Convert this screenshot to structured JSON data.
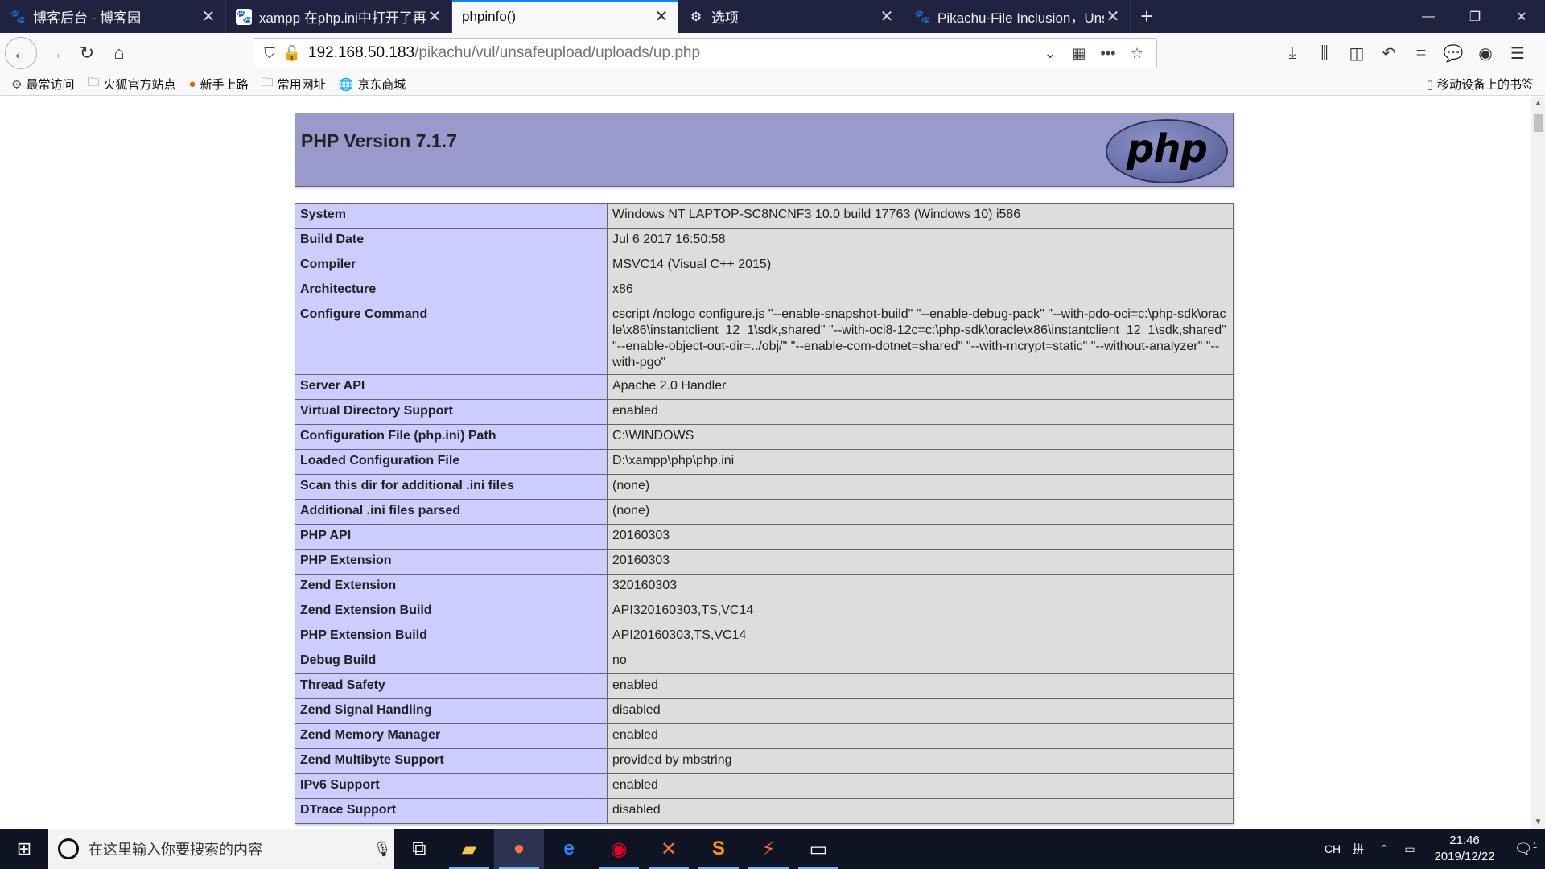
{
  "tabs": [
    {
      "title": "博客后台 - 博客园",
      "icon": "paw-icon",
      "active": false
    },
    {
      "title": "xampp 在php.ini中打开了再测",
      "icon": "baidu-paw-icon",
      "active": false
    },
    {
      "title": "phpinfo()",
      "icon": "",
      "active": true
    },
    {
      "title": "选项",
      "icon": "gear-icon",
      "active": false
    },
    {
      "title": "Pikachu-File Inclusion，Unsa",
      "icon": "paw-icon",
      "active": false
    }
  ],
  "url": {
    "host": "192.168.50.183",
    "path": "/pikachu/vul/unsafeupload/uploads/up.php"
  },
  "bookmarks": [
    {
      "label": "最常访问",
      "icon": "gear-icon"
    },
    {
      "label": "火狐官方站点",
      "icon": "folder-icon"
    },
    {
      "label": "新手上路",
      "icon": "firefox-icon"
    },
    {
      "label": "常用网址",
      "icon": "folder-icon"
    },
    {
      "label": "京东商城",
      "icon": "globe-icon"
    }
  ],
  "mobile_bookmarks": "移动设备上的书签",
  "php": {
    "version_title": "PHP Version 7.1.7",
    "logo_text": "php"
  },
  "info_rows": [
    {
      "key": "System",
      "value": "Windows NT LAPTOP-SC8NCNF3 10.0 build 17763 (Windows 10) i586"
    },
    {
      "key": "Build Date",
      "value": "Jul 6 2017 16:50:58"
    },
    {
      "key": "Compiler",
      "value": "MSVC14 (Visual C++ 2015)"
    },
    {
      "key": "Architecture",
      "value": "x86"
    },
    {
      "key": "Configure Command",
      "value": "cscript /nologo configure.js \"--enable-snapshot-build\" \"--enable-debug-pack\" \"--with-pdo-oci=c:\\php-sdk\\oracle\\x86\\instantclient_12_1\\sdk,shared\" \"--with-oci8-12c=c:\\php-sdk\\oracle\\x86\\instantclient_12_1\\sdk,shared\" \"--enable-object-out-dir=../obj/\" \"--enable-com-dotnet=shared\" \"--with-mcrypt=static\" \"--without-analyzer\" \"--with-pgo\""
    },
    {
      "key": "Server API",
      "value": "Apache 2.0 Handler"
    },
    {
      "key": "Virtual Directory Support",
      "value": "enabled"
    },
    {
      "key": "Configuration File (php.ini) Path",
      "value": "C:\\WINDOWS"
    },
    {
      "key": "Loaded Configuration File",
      "value": "D:\\xampp\\php\\php.ini"
    },
    {
      "key": "Scan this dir for additional .ini files",
      "value": "(none)"
    },
    {
      "key": "Additional .ini files parsed",
      "value": "(none)"
    },
    {
      "key": "PHP API",
      "value": "20160303"
    },
    {
      "key": "PHP Extension",
      "value": "20160303"
    },
    {
      "key": "Zend Extension",
      "value": "320160303"
    },
    {
      "key": "Zend Extension Build",
      "value": "API320160303,TS,VC14"
    },
    {
      "key": "PHP Extension Build",
      "value": "API20160303,TS,VC14"
    },
    {
      "key": "Debug Build",
      "value": "no"
    },
    {
      "key": "Thread Safety",
      "value": "enabled"
    },
    {
      "key": "Zend Signal Handling",
      "value": "disabled"
    },
    {
      "key": "Zend Memory Manager",
      "value": "enabled"
    },
    {
      "key": "Zend Multibyte Support",
      "value": "provided by mbstring"
    },
    {
      "key": "IPv6 Support",
      "value": "enabled"
    },
    {
      "key": "DTrace Support",
      "value": "disabled"
    }
  ],
  "taskbar": {
    "search_placeholder": "在这里输入你要搜索的内容",
    "apps": [
      {
        "name": "task-view-icon",
        "running": false
      },
      {
        "name": "file-explorer-icon",
        "running": true
      },
      {
        "name": "firefox-icon",
        "running": true
      },
      {
        "name": "edge-icon",
        "running": false
      },
      {
        "name": "netease-music-icon",
        "running": true
      },
      {
        "name": "xampp-icon",
        "running": true
      },
      {
        "name": "sublime-icon",
        "running": true
      },
      {
        "name": "burp-icon",
        "running": true
      },
      {
        "name": "terminal-icon",
        "running": true
      }
    ],
    "ime": "CH",
    "ime2": "拼",
    "time": "21:46",
    "date": "2019/12/22",
    "notification_count": "1"
  },
  "colors": {
    "tabstrip": "#202340",
    "php_header": "#9999cc",
    "key_cell": "#ccccff",
    "value_cell": "#dddddd",
    "accent": "#0a84ff"
  }
}
